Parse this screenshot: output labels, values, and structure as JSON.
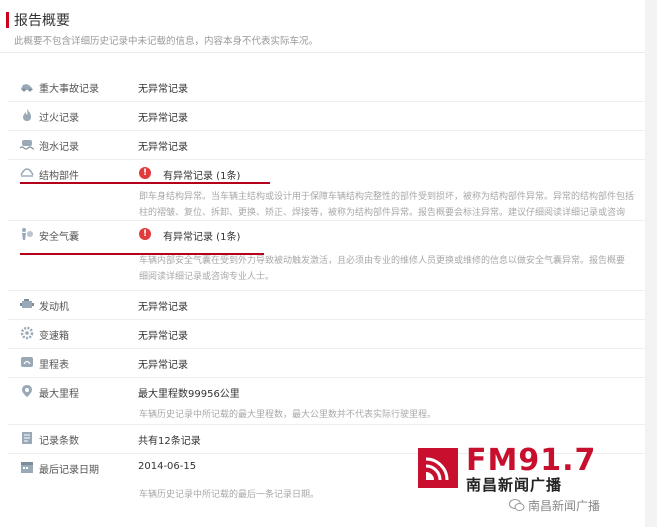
{
  "header": {
    "title": "报告概要",
    "subtitle": "此概要不包含详细历史记录中未记载的信息，内容本身不代表实际车况。"
  },
  "rows": [
    {
      "label": "重大事故记录",
      "value": "无异常记录",
      "icon": "accident-car-icon"
    },
    {
      "label": "过火记录",
      "value": "无异常记录",
      "icon": "fire-icon"
    },
    {
      "label": "泡水记录",
      "value": "无异常记录",
      "icon": "water-icon"
    },
    {
      "label": "结构部件",
      "value": "有异常记录 (1条)",
      "icon": "car-structure-icon",
      "status": "warning",
      "desc": [
        "即车身结构异常。当车辆主结构或设计用于保障车辆结构完整性的部件受到损坏，被称为结构部件异常。异常的结构部件包括",
        "柱的褶皱、复位、拆卸、更换、矫正、焊接等，被称为结构部件异常。报告概要会标注异常。建议仔细阅读详细记录或咨询"
      ]
    },
    {
      "label": "安全气囊",
      "value": "有异常记录 (1条)",
      "icon": "airbag-icon",
      "status": "warning",
      "desc": [
        "车辆内部安全气囊在受到外力导致被动触发激活，且必须由专业的维修人员更换或维修的信息以做安全气囊异常。报告概要",
        "细阅读详细记录或咨询专业人士。"
      ]
    },
    {
      "label": "发动机",
      "value": "无异常记录",
      "icon": "engine-icon"
    },
    {
      "label": "变速箱",
      "value": "无异常记录",
      "icon": "gearbox-icon"
    },
    {
      "label": "里程表",
      "value": "无异常记录",
      "icon": "odometer-icon"
    },
    {
      "label": "最大里程",
      "value": "最大里程数99956公里",
      "icon": "location-pin-icon",
      "desc": [
        "车辆历史记录中所记载的最大里程数，最大公里数并不代表实际行驶里程。"
      ]
    },
    {
      "label": "记录条数",
      "value": "共有12条记录",
      "icon": "record-list-icon"
    },
    {
      "label": "最后记录日期",
      "value": "2014-06-15",
      "icon": "calendar-icon",
      "desc": [
        "车辆历史记录中所记载的最后一条记录日期。"
      ]
    }
  ],
  "logo": {
    "fm": "FM91.7",
    "name": "南昌新闻广播"
  },
  "watermark": {
    "text": "南昌新闻广播",
    "icon": "wechat-icon"
  },
  "colors": {
    "accent": "#d0021b",
    "warning": "#e23b3b",
    "underline": "#b4001b",
    "logo": "#c8102e"
  }
}
